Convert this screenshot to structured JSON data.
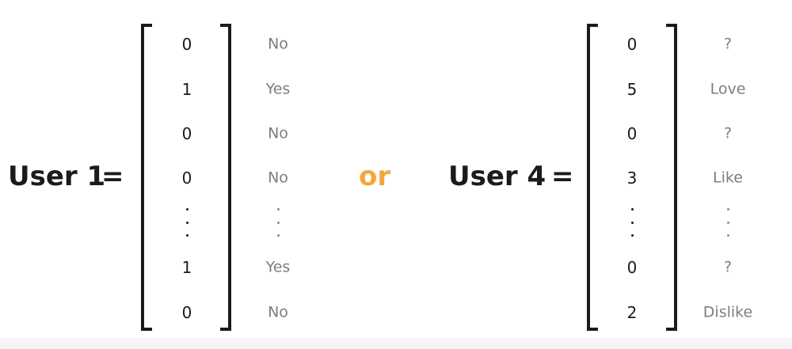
{
  "left": {
    "label": "User 1",
    "equals": "=",
    "values": [
      "0",
      "1",
      "0",
      "0",
      "⋮",
      "1",
      "0"
    ],
    "notes": [
      "No",
      "Yes",
      "No",
      "No",
      "⋮",
      "Yes",
      "No"
    ]
  },
  "connector": "or",
  "right": {
    "label": "User 4",
    "equals": "=",
    "values": [
      "0",
      "5",
      "0",
      "3",
      "⋮",
      "0",
      "2"
    ],
    "notes": [
      "?",
      "Love",
      "?",
      "Like",
      "⋮",
      "?",
      "Dislike"
    ]
  },
  "colors": {
    "text": "#1b1b1f",
    "note": "#7b7d85",
    "accent": "#f4a63c"
  }
}
